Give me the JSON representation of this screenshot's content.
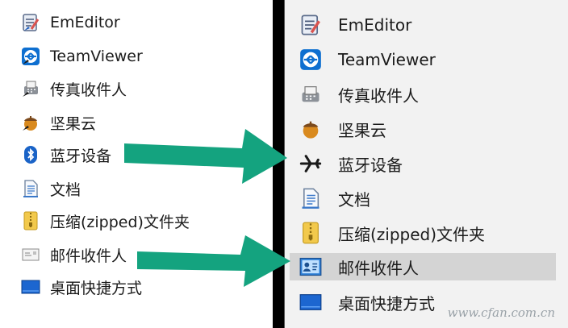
{
  "left_menu": {
    "items": [
      {
        "label": "EmEditor",
        "icon": "emeditor-icon"
      },
      {
        "label": "TeamViewer",
        "icon": "teamviewer-icon"
      },
      {
        "label": "传真收件人",
        "icon": "fax-icon"
      },
      {
        "label": "坚果云",
        "icon": "nutstore-icon"
      },
      {
        "label": "蓝牙设备",
        "icon": "bluetooth-icon"
      },
      {
        "label": "文档",
        "icon": "document-icon"
      },
      {
        "label": "压缩(zipped)文件夹",
        "icon": "zip-folder-icon"
      },
      {
        "label": "邮件收件人",
        "icon": "mail-icon"
      },
      {
        "label": "桌面快捷方式",
        "icon": "desktop-icon"
      }
    ]
  },
  "right_menu": {
    "items": [
      {
        "label": "EmEditor",
        "icon": "emeditor-icon"
      },
      {
        "label": "TeamViewer",
        "icon": "teamviewer-icon"
      },
      {
        "label": "传真收件人",
        "icon": "fax-icon"
      },
      {
        "label": "坚果云",
        "icon": "nutstore-icon"
      },
      {
        "label": "蓝牙设备",
        "icon": "airplane-icon"
      },
      {
        "label": "文档",
        "icon": "document-icon"
      },
      {
        "label": "压缩(zipped)文件夹",
        "icon": "zip-folder-icon"
      },
      {
        "label": "邮件收件人",
        "icon": "mail-contact-icon",
        "selected": true
      },
      {
        "label": "桌面快捷方式",
        "icon": "desktop-icon"
      }
    ]
  },
  "watermark": "www.cfan.com.cn",
  "colors": {
    "arrow": "#14a37f",
    "selected_bg": "#d4d4d4"
  }
}
